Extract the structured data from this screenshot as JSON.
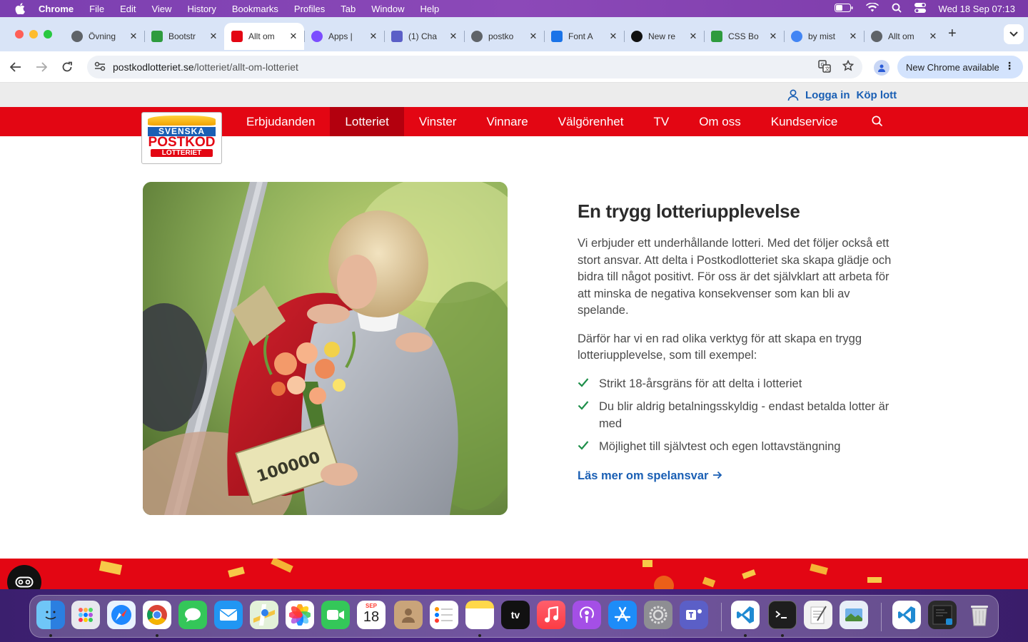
{
  "menubar": {
    "app": "Chrome",
    "items": [
      "File",
      "Edit",
      "View",
      "History",
      "Bookmarks",
      "Profiles",
      "Tab",
      "Window",
      "Help"
    ],
    "clock": "Wed 18 Sep  07:13"
  },
  "tabs": [
    {
      "title": "Övning",
      "favicon": "globe-icon",
      "color": "#5f6368"
    },
    {
      "title": "Bootstr",
      "favicon": "w-icon",
      "color": "#2e9b3e"
    },
    {
      "title": "Allt om",
      "favicon": "postkod-icon",
      "color": "#e30613",
      "active": true
    },
    {
      "title": "Apps |",
      "favicon": "apps-icon",
      "color": "#7c4dff"
    },
    {
      "title": "(1) Cha",
      "favicon": "teams-icon",
      "color": "#5b5fc7"
    },
    {
      "title": "postko",
      "favicon": "globe-icon",
      "color": "#5f6368"
    },
    {
      "title": "Font A",
      "favicon": "flag-icon",
      "color": "#1a73e8"
    },
    {
      "title": "New re",
      "favicon": "github-icon",
      "color": "#111111"
    },
    {
      "title": "CSS Bo",
      "favicon": "w-icon",
      "color": "#2e9b3e"
    },
    {
      "title": "by mist",
      "favicon": "google-icon",
      "color": "#4285f4"
    },
    {
      "title": "Allt om",
      "favicon": "globe-icon",
      "color": "#5f6368"
    }
  ],
  "omnibox": {
    "host": "postkodlotteriet.se",
    "path": "/lotteriet/allt-om-lotteriet"
  },
  "update_chip": "New Chrome available",
  "site": {
    "login": "Logga in",
    "buy": "Köp lott",
    "logo": {
      "line1": "SVENSKA",
      "line2": "POSTKOD",
      "line3": "LOTTERIET"
    },
    "nav": [
      {
        "label": "Erbjudanden"
      },
      {
        "label": "Lotteriet",
        "active": true
      },
      {
        "label": "Vinster"
      },
      {
        "label": "Vinnare"
      },
      {
        "label": "Välgörenhet"
      },
      {
        "label": "TV"
      },
      {
        "label": "Om oss"
      },
      {
        "label": "Kundservice"
      }
    ]
  },
  "article": {
    "heading": "En trygg lotteriupplevelse",
    "para1": "Vi erbjuder ett underhållande lotteri. Med det följer också ett stort ansvar. Att delta i Postkodlotteriet ska skapa glädje och bidra till något positivt. För oss är det självklart att arbeta för att minska de negativa konsekvenser som kan bli av spelande.",
    "para2": "Därför har vi en rad olika verktyg för att skapa en trygg lotteriupplevelse, som till exempel:",
    "checklist": [
      "Strikt 18-årsgräns för att delta i lotteriet",
      "Du blir aldrig betalningsskyldig - endast betalda lotter är med",
      "Möjlighet till självtest och egen lottavstängning"
    ],
    "readmore": "Läs mer om spelansvar",
    "photo_check_text": "100000"
  },
  "dock": {
    "calendar_month": "SEP",
    "calendar_day": "18",
    "tv_label": "tv"
  }
}
